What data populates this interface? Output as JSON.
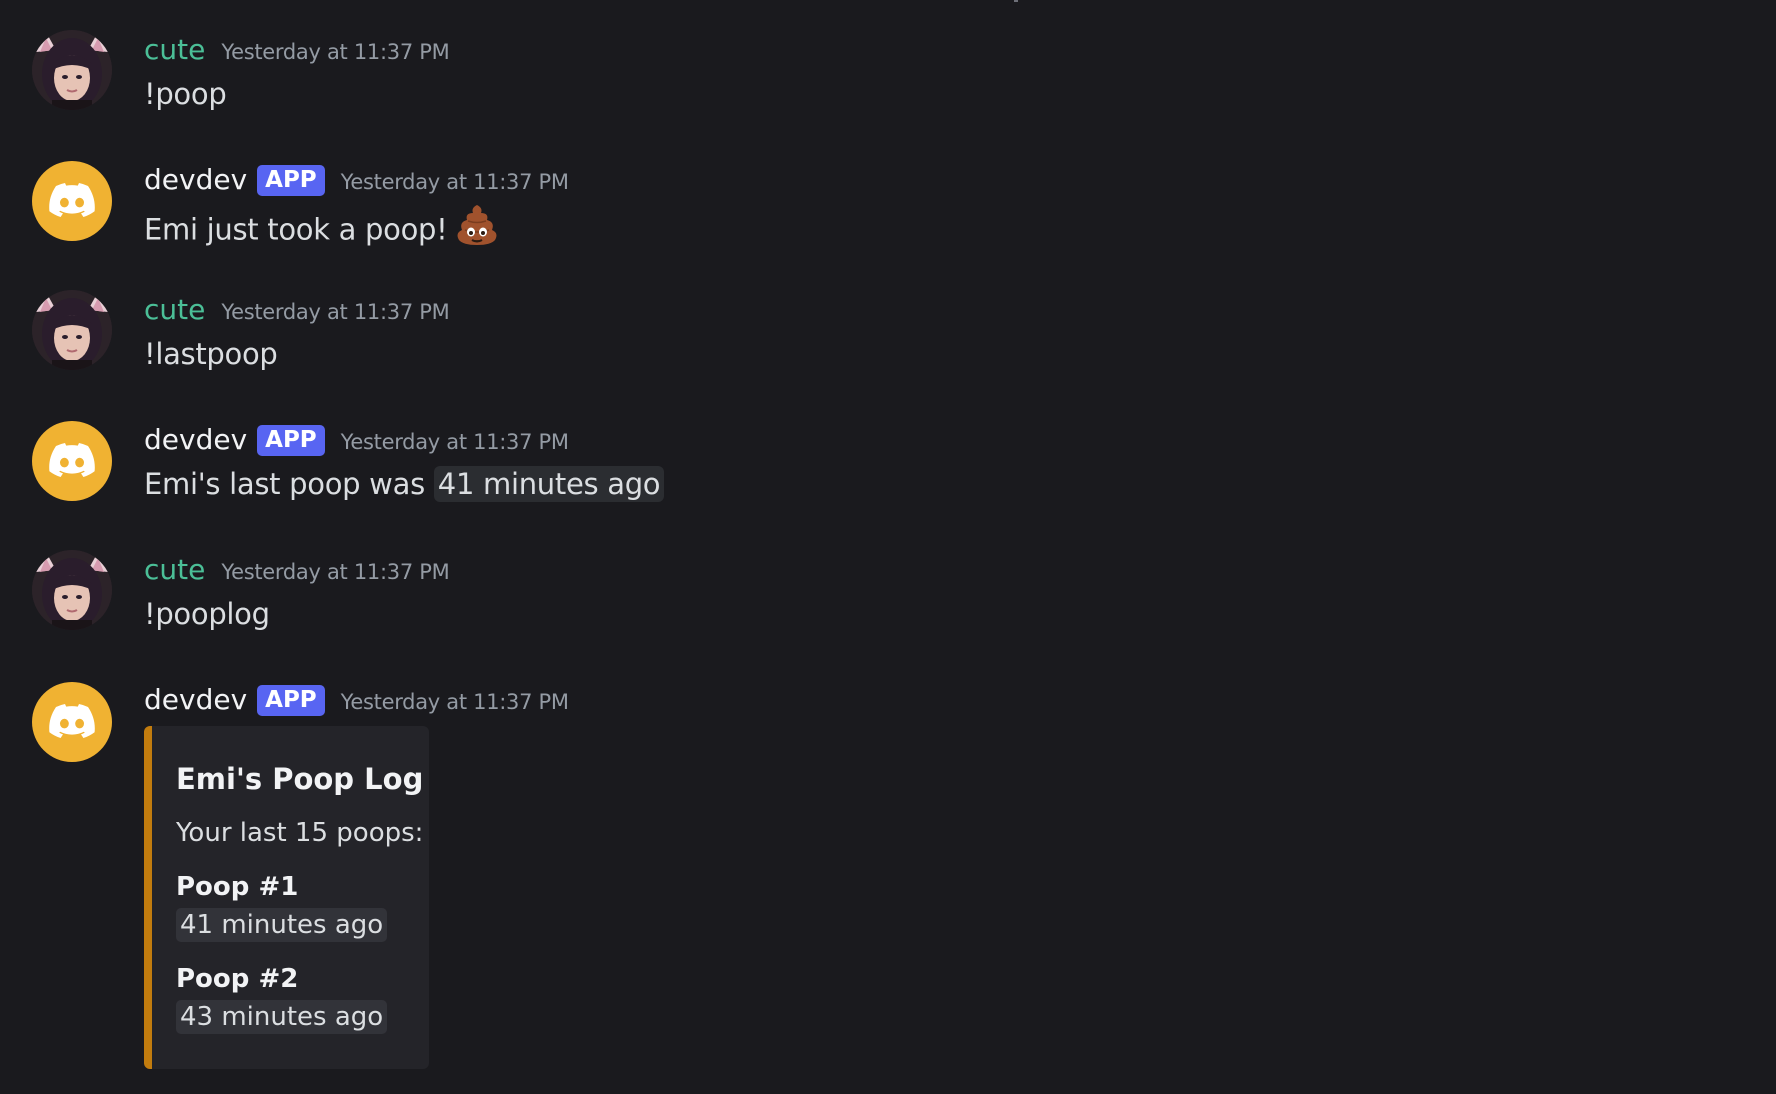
{
  "colors": {
    "background": "#1a1a1e",
    "user_name": "#4bbf97",
    "bot_name": "#f2f3f5",
    "app_tag": "#5865f2",
    "bot_avatar": "#f0b232",
    "embed_accent": "#c27c0e",
    "timestamp": "#949ba4"
  },
  "messages": [
    {
      "author": "cute",
      "timestamp": "Yesterday at 11:37 PM",
      "text": "!poop"
    },
    {
      "author": "devdev",
      "badge": "APP",
      "timestamp": "Yesterday at 11:37 PM",
      "text": "Emi just took a poop!",
      "emoji": "poop-emoji"
    },
    {
      "author": "cute",
      "timestamp": "Yesterday at 11:37 PM",
      "text": "!lastpoop"
    },
    {
      "author": "devdev",
      "badge": "APP",
      "timestamp": "Yesterday at 11:37 PM",
      "text_prefix": "Emi's last poop was ",
      "inline_time": "41 minutes ago"
    },
    {
      "author": "cute",
      "timestamp": "Yesterday at 11:37 PM",
      "text": "!pooplog"
    },
    {
      "author": "devdev",
      "badge": "APP",
      "timestamp": "Yesterday at 11:37 PM",
      "embed": {
        "title": "Emi's Poop Log",
        "description": "Your last 15 poops:",
        "fields": [
          {
            "name": "Poop #1",
            "value": "41 minutes ago"
          },
          {
            "name": "Poop #2",
            "value": "43 minutes ago"
          }
        ]
      }
    }
  ]
}
